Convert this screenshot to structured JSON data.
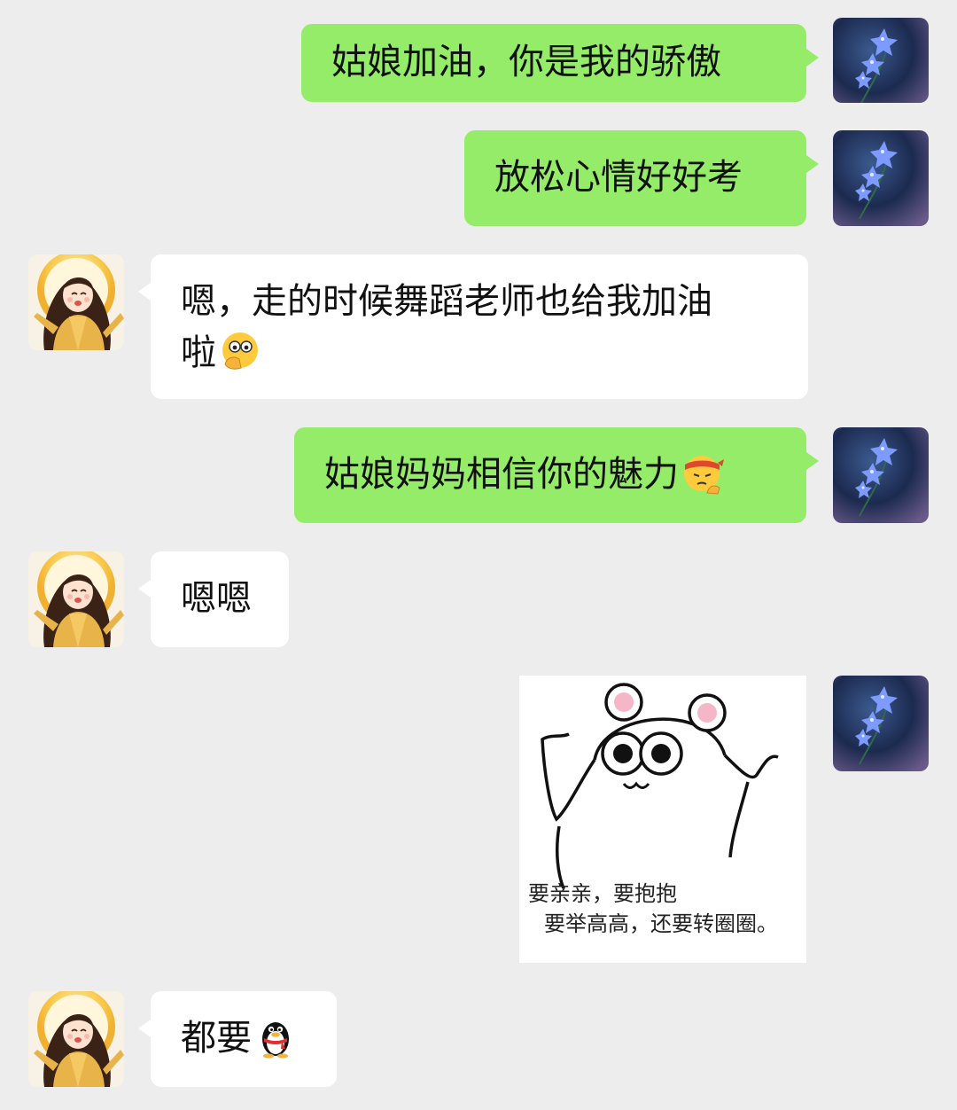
{
  "messages": [
    {
      "sender": "me",
      "text": "姑娘加油，你是我的骄傲"
    },
    {
      "sender": "me",
      "text": "放松心情好好考"
    },
    {
      "sender": "other",
      "line1": "嗯，走的时候舞蹈老师也给我加油",
      "line2": "啦",
      "emoji": "thinking-face-emoji"
    },
    {
      "sender": "me",
      "text": "姑娘妈妈相信你的魅力",
      "emoji": "determined-headband-face-emoji"
    },
    {
      "sender": "other",
      "text": "嗯嗯"
    },
    {
      "sender": "me",
      "sticker": {
        "caption_line1": "要亲亲，要抱抱",
        "caption_line2": "要举高高，还要转圈圈。"
      }
    },
    {
      "sender": "other",
      "text": "都要",
      "emoji": "qq-penguin-emoji"
    }
  ],
  "colors": {
    "background": "#ededed",
    "my_bubble": "#95ec69",
    "other_bubble": "#ffffff"
  },
  "icons": {
    "my_avatar": "purple-flower-avatar",
    "other_avatar": "cartoon-girl-avatar"
  }
}
